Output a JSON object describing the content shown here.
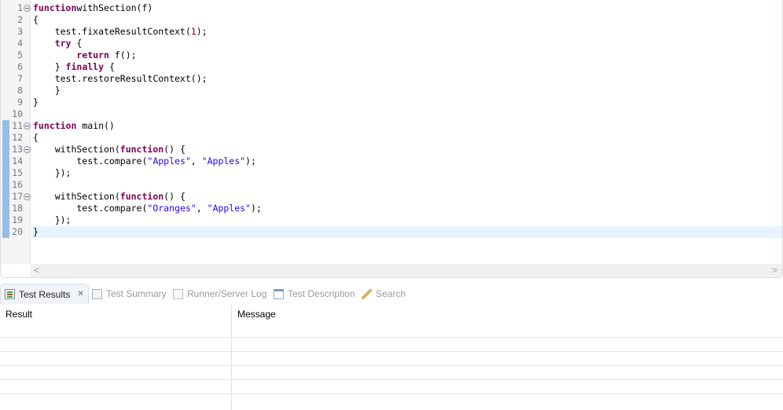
{
  "editor": {
    "lines": [
      [
        [
          "kw",
          "function"
        ],
        [
          "",
          "withSection(f)"
        ]
      ],
      [
        [
          "",
          "{"
        ]
      ],
      [
        [
          "",
          "    test.fixateResultContext("
        ],
        [
          "num",
          "1"
        ],
        [
          "",
          ");"
        ]
      ],
      [
        [
          "",
          "    "
        ],
        [
          "kw",
          "try"
        ],
        [
          "",
          " {"
        ]
      ],
      [
        [
          "",
          "        "
        ],
        [
          "kw",
          "return"
        ],
        [
          "",
          " f();"
        ]
      ],
      [
        [
          "",
          "    } "
        ],
        [
          "kw",
          "finally"
        ],
        [
          "",
          " {"
        ]
      ],
      [
        [
          "",
          "    test.restoreResultContext();"
        ]
      ],
      [
        [
          "",
          "    }"
        ]
      ],
      [
        [
          "",
          "}"
        ]
      ],
      [],
      [
        [
          "kw",
          "function"
        ],
        [
          "",
          " main()"
        ]
      ],
      [
        [
          "",
          "{"
        ]
      ],
      [
        [
          "",
          "    withSection("
        ],
        [
          "kw",
          "function"
        ],
        [
          "",
          "() {"
        ]
      ],
      [
        [
          "",
          "        test.compare("
        ],
        [
          "str",
          "\"Apples\""
        ],
        [
          "",
          ", "
        ],
        [
          "str",
          "\"Apples\""
        ],
        [
          "",
          ");"
        ]
      ],
      [
        [
          "",
          "    });"
        ]
      ],
      [],
      [
        [
          "",
          "    withSection("
        ],
        [
          "kw",
          "function"
        ],
        [
          "",
          "() {"
        ]
      ],
      [
        [
          "",
          "        test.compare("
        ],
        [
          "str",
          "\"Oranges\""
        ],
        [
          "",
          ", "
        ],
        [
          "str",
          "\"Apples\""
        ],
        [
          "",
          ");"
        ]
      ],
      [
        [
          "",
          "    });"
        ]
      ],
      [
        [
          "",
          "}"
        ]
      ]
    ],
    "folds": [
      1,
      11,
      13,
      17
    ],
    "markers": [
      11,
      12,
      13,
      14,
      15,
      16,
      17,
      18,
      19,
      20
    ],
    "current_line": 20,
    "scroll_left": "<",
    "scroll_right": ">"
  },
  "tabs": [
    {
      "label": "Test Results",
      "icon": "test-results-icon",
      "active": true,
      "close": "✕"
    },
    {
      "label": "Test Summary",
      "icon": "test-summary-icon"
    },
    {
      "label": "Runner/Server Log",
      "icon": "log-icon"
    },
    {
      "label": "Test Description",
      "icon": "window-icon"
    },
    {
      "label": "Search",
      "icon": "search-icon"
    }
  ],
  "table": {
    "columns": [
      "Result",
      "Message"
    ],
    "rows": 5
  }
}
